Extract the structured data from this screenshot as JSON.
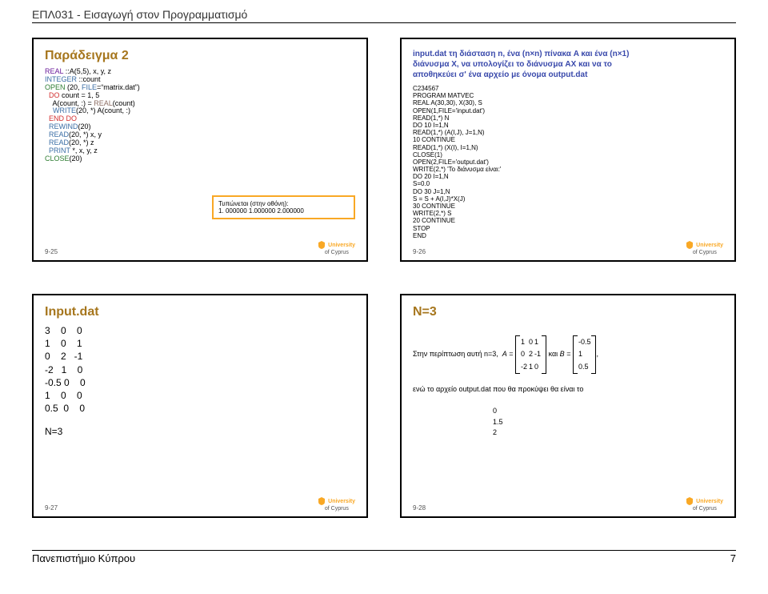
{
  "header": "ΕΠΛ031 - Εισαγωγή στον Προγραμματισμό",
  "footer": {
    "left": "Πανεπιστήμιο Κύπρου",
    "right": "7"
  },
  "uni": {
    "line1": "University",
    "line2": "of Cyprus"
  },
  "slides": {
    "s25": {
      "num": "9-25",
      "title": "Παράδειγμα 2",
      "code": [
        "REAL ::A(5,5), x, y, z",
        "INTEGER ::count",
        "OPEN (20, FILE=\"matrix.dat\")",
        "  DO count = 1, 5",
        "    A(count, :) = REAL(count)",
        "    WRITE(20, *) A(count, :)",
        "  END DO",
        "  REWIND(20)",
        "  READ(20, *) x, y",
        "  READ(20, *) z",
        "  PRINT *, x, y, z",
        "CLOSE(20)"
      ],
      "printbox": {
        "label": "Τυπώνεται (στην οθόνη):",
        "values": "1. 000000   1.000000   2.000000"
      }
    },
    "s26": {
      "num": "9-26",
      "title_lines": [
        "input.dat τη διάσταση n, ένα (n×n) πίνακα A και ένα (n×1)",
        "διάνυσμα X, να υπολογίζει το διάνυσμα AX και να το",
        "αποθηκεύει σ' ένα αρχείο με όνομα output.dat"
      ],
      "code": "C234567\nPROGRAM MATVEC\nREAL A(30,30), X(30), S\nOPEN(1,FILE='input.dat')\nREAD(1,*) N\nDO 10 I=1,N\nREAD(1,*) (A(I,J), J=1,N)\n10 CONTINUE\nREAD(1,*) (X(I), I=1,N)\nCLOSE(1)\nOPEN(2,FILE='output.dat')\nWRITE(2,*) 'Το διάνυσμα είναι:'\nDO 20 I=1,N\nS=0.0\nDO 30 J=1,N\nS = S + A(I,J)*X(J)\n30 CONTINUE\nWRITE(2,*) S\n20 CONTINUE\nSTOP\nEND"
    },
    "s27": {
      "num": "9-27",
      "title": "Ιnput.dat",
      "rows": [
        "3    0    0",
        "1    0    1",
        "0    2   -1",
        "-2   1    0",
        "-0.5 0    0",
        "1    0    0",
        "0.5  0    0"
      ],
      "n_label": "N=3"
    },
    "s28": {
      "num": "9-28",
      "title": "Ν=3",
      "eq_prefix": "Στην περίπτωση αυτή n=3,",
      "eq_mid": " και ",
      "eq_after": "ενώ το αρχείο output.dat που θα προκύψει θα είναι το",
      "A": [
        [
          "1",
          "0",
          "1"
        ],
        [
          "0",
          "2",
          "-1"
        ],
        [
          "-2",
          "1",
          "0"
        ]
      ],
      "B": [
        [
          "-0.5"
        ],
        [
          "1"
        ],
        [
          "0.5"
        ]
      ],
      "out": [
        "0",
        "1.5",
        "2"
      ]
    }
  }
}
